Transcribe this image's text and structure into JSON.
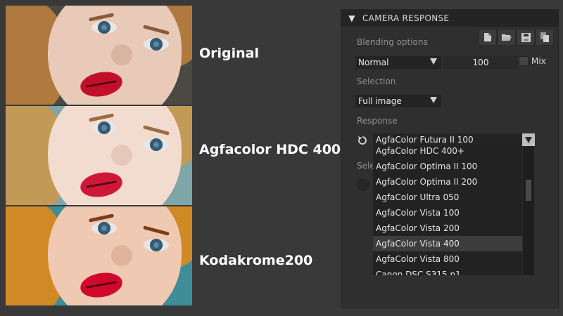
{
  "comparison": {
    "labels": [
      "Original",
      "Agfacolor HDC 400+",
      "Kodakrome200"
    ]
  },
  "panel": {
    "title": "CAMERA RESPONSE",
    "toolbar_icons": [
      "file-icon",
      "folder-open-icon",
      "save-icon",
      "copy-icon"
    ],
    "blending": {
      "label": "Blending options",
      "mode": "Normal",
      "opacity": "100",
      "mix_label": "Mix"
    },
    "selection": {
      "label": "Selection",
      "value": "Full image"
    },
    "response": {
      "label": "Response",
      "value": "AgfaColor Futura II 100",
      "items": [
        "AgfaColor HDC 400+",
        "AgfaColor Optima II 100",
        "AgfaColor Optima II 200",
        "AgfaColor Ultra 050",
        "AgfaColor Vista 100",
        "AgfaColor Vista 200",
        "AgfaColor Vista 400",
        "AgfaColor Vista 800",
        "Canon DSC S315 n1"
      ],
      "highlighted": "AgfaColor Vista 400"
    },
    "obscured_label": "Sele"
  },
  "colors": {
    "panel_bg": "#2f2f2f",
    "header_bg": "#242424",
    "highlight": "#3c3c3c"
  }
}
